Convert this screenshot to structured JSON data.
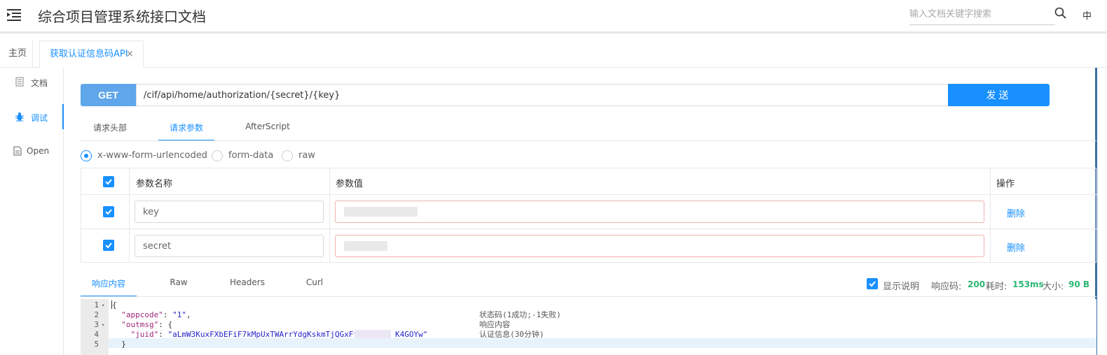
{
  "header": {
    "title": "综合项目管理系统接口文档",
    "search_placeholder": "输入文档关键字搜索",
    "lang": "中"
  },
  "tabs": [
    {
      "label": "主页"
    },
    {
      "label": "获取认证信息码API",
      "close": "×"
    }
  ],
  "leftnav": [
    {
      "label": "文档",
      "icon": "document-icon"
    },
    {
      "label": "调试",
      "icon": "bug-icon",
      "active": true
    },
    {
      "label": "Open",
      "icon": "file-icon"
    }
  ],
  "request": {
    "method": "GET",
    "url": "/cif/api/home/authorization/{secret}/{key}",
    "send_label": "发送"
  },
  "req_tabs": [
    "请求头部",
    "请求参数",
    "AfterScript"
  ],
  "content_types": [
    "x-www-form-urlencoded",
    "form-data",
    "raw"
  ],
  "params": {
    "headers": {
      "name": "参数名称",
      "value": "参数值",
      "action": "操作"
    },
    "rows": [
      {
        "name": "key",
        "value": "",
        "delete": "删除",
        "checked": true
      },
      {
        "name": "secret",
        "value": "",
        "delete": "删除",
        "checked": true
      }
    ]
  },
  "resp_tabs": [
    "响应内容",
    "Raw",
    "Headers",
    "Curl"
  ],
  "response": {
    "show_desc": "显示说明",
    "code_label": "响应码:",
    "code": "200",
    "time_label": "耗时:",
    "time": "153ms",
    "size_label": "大小:",
    "size": "90 B"
  },
  "code": {
    "lines": [
      {
        "num": "1",
        "fold": "▾"
      },
      {
        "num": "2",
        "fold": ""
      },
      {
        "num": "3",
        "fold": "▾"
      },
      {
        "num": "4",
        "fold": ""
      },
      {
        "num": "5",
        "fold": ""
      }
    ],
    "l1": "{",
    "l2_key": "\"appcode\"",
    "l2_rest": ": ",
    "l2_val": "\"1\"",
    "l2_end": ",",
    "l3_key": "\"outmsg\"",
    "l3_rest": ": {",
    "l4_key": "\"juid\"",
    "l4_rest": ": ",
    "l4_val_a": "\"aLmW3KuxFXbEFiF7kMpUxTWArrYdgKskmTjQGxFt",
    "l4_val_b": "K4GOYw\"",
    "l5": "  }",
    "cmt2": "状态码(1成功;-1失败)",
    "cmt3": "响应内容",
    "cmt4": "认证信息(30分钟)"
  },
  "colors": {
    "accent": "#1890ff",
    "method_bg": "#5fa6ea",
    "success": "#2bb673"
  }
}
